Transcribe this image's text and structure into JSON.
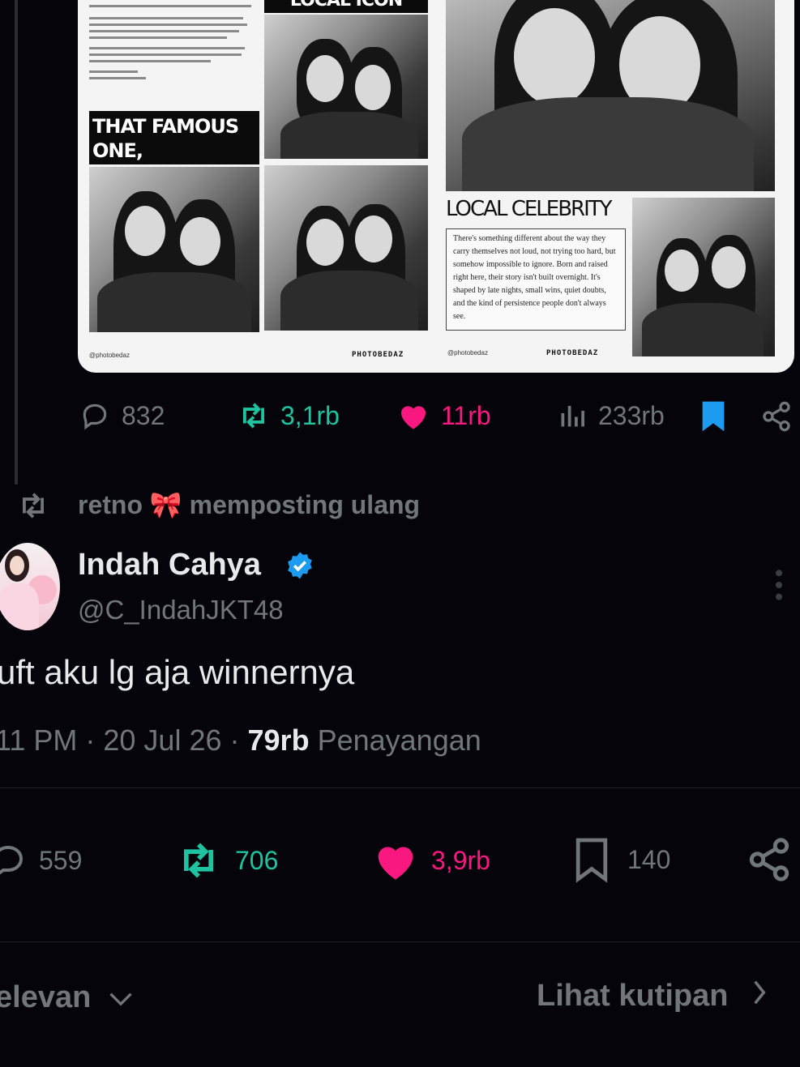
{
  "media": {
    "heading_left": "THAT FAMOUS ONE, OBVIOUSLY",
    "heading_top": "LOCAL ICON SPOTTED",
    "heading_right": "LOCAL CELEBRITY",
    "celebrity_text": "There's something different about the way they carry themselves not loud, not trying too hard, but somehow impossible to ignore. Born and raised right here, their story isn't built overnight. It's shaped by late nights, small wins, quiet doubts, and the kind of persistence people don't always see.",
    "footer_handle_left": "@photobedaz",
    "footer_brand_left": "PHOTOBEDAZ",
    "footer_handle_right": "@photobedaz",
    "footer_brand_right": "PHOTOBEDAZ"
  },
  "top_actions": {
    "replies": "832",
    "reposts": "3,1rb",
    "likes": "11rb",
    "views": "233rb"
  },
  "repost_banner": "retno 🎀 memposting ulang",
  "post": {
    "name": "Indah Cahya",
    "handle": "@C_IndahJKT48",
    "text": "uft aku lg aja winnernya",
    "time": "11 PM",
    "date": "20 Jul 26",
    "views_count": "79rb",
    "views_label": "Penayangan"
  },
  "post_actions": {
    "replies": "559",
    "reposts": "706",
    "likes": "3,9rb",
    "bookmarks": "140"
  },
  "footer": {
    "sort_label": "elevan",
    "quotes_label": "Lihat kutipan"
  },
  "colors": {
    "green": "#1ec4a0",
    "pink": "#f91880",
    "blue": "#1d9bf0",
    "gray": "#71767b"
  }
}
